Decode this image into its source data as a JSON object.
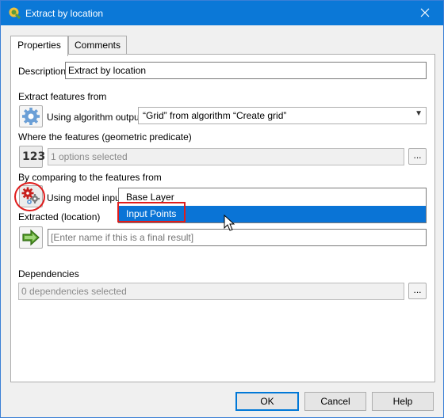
{
  "window": {
    "title": "Extract by location"
  },
  "tabs": [
    {
      "label": "Properties"
    },
    {
      "label": "Comments"
    }
  ],
  "description": {
    "label": "Description",
    "value": "Extract by location"
  },
  "extract_from": {
    "section_label": "Extract features from",
    "source_label": "Using algorithm output",
    "value": "“Grid” from algorithm “Create grid”"
  },
  "predicate": {
    "section_label": "Where the features (geometric predicate)",
    "value": "1 options selected",
    "browse_label": "..."
  },
  "comparing": {
    "section_label": "By comparing to the features from",
    "source_label": "Using model input"
  },
  "dropdown": {
    "options": [
      {
        "label": "Base Layer"
      },
      {
        "label": "Input Points"
      }
    ]
  },
  "extracted": {
    "label": "Extracted (location)",
    "placeholder": "[Enter name if this is a final result]"
  },
  "dependencies": {
    "label": "Dependencies",
    "value": "0 dependencies selected",
    "browse_label": "..."
  },
  "buttons": {
    "ok": "OK",
    "cancel": "Cancel",
    "help": "Help"
  },
  "icons": {
    "app": "qgis-icon",
    "algorithm": "gear-icon",
    "predicate": "number-123-icon",
    "model_input": "model-input-gears-icon",
    "output": "green-arrow-icon"
  },
  "colors": {
    "titlebar": "#0b78d7",
    "selection": "#0a74d6",
    "highlight": "#e01c1c"
  }
}
